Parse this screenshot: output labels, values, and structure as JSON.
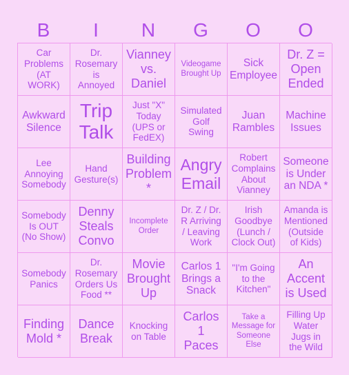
{
  "header": {
    "letters": [
      "B",
      "I",
      "N",
      "G",
      "O",
      "O"
    ]
  },
  "colors": {
    "background": "#f9d9f9",
    "text": "#b04ee8",
    "grid_line": "#ee99ee"
  },
  "cells": [
    [
      "Car\nProblems\n(AT\nWORK)",
      "Dr.\nRosemary\nis\nAnnoyed",
      "Vianney\nvs.\nDaniel",
      "Videogame\nBrought Up",
      "Sick\nEmployee",
      "Dr. Z =\nOpen\nEnded"
    ],
    [
      "Awkward\nSilence",
      "Trip\nTalk",
      "Just \"X\"\nToday\n(UPS or\nFedEX)",
      "Simulated\nGolf\nSwing",
      "Juan\nRambles",
      "Machine\nIssues"
    ],
    [
      "Lee\nAnnoying\nSomebody",
      "Hand\nGesture(s)",
      "Building\nProblem\n*",
      "Angry\nEmail",
      "Robert\nComplains\nAbout\nVianney",
      "Someone\nis Under\nan NDA *"
    ],
    [
      "Somebody\nIs OUT\n(No Show)",
      "Denny\nSteals\nConvo",
      "Incomplete\nOrder",
      "Dr. Z / Dr.\nR Arriving\n/ Leaving\nWork",
      "Irish\nGoodbye\n(Lunch /\nClock Out)",
      "Amanda is\nMentioned\n(Outside\nof Kids)"
    ],
    [
      "Somebody\nPanics",
      "Dr.\nRosemary\nOrders Us\nFood **",
      "Movie\nBrought\nUp",
      "Carlos 1\nBrings a\nSnack",
      "\"I'm Going\nto the\nKitchen\"",
      "An\nAccent\nis Used"
    ],
    [
      "Finding\nMold *",
      "Dance\nBreak",
      "Knocking\non Table",
      "Carlos\n1\nPaces",
      "Take a\nMessage for\nSomeone\nElse",
      "Filling Up\nWater\nJugs in\nthe Wild"
    ]
  ]
}
